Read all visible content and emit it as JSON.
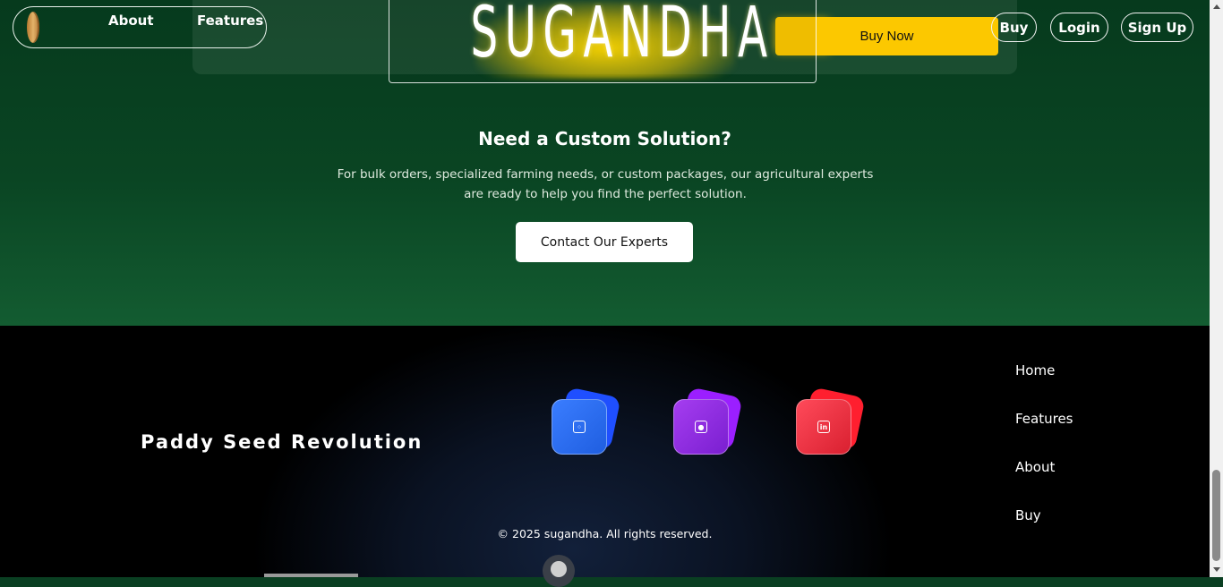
{
  "brand": {
    "logo_text": "SUGANDHA"
  },
  "product_card": {
    "buy_now_label": "Buy Now"
  },
  "nav": {
    "left_links": [
      "About",
      "Features"
    ],
    "right_buttons": [
      "Buy",
      "Login",
      "Sign Up"
    ],
    "logo_icon": "seed-icon"
  },
  "cta": {
    "title": "Need a Custom Solution?",
    "description": "For bulk orders, specialized farming needs, or custom packages, our agricultural experts are ready to help you find the perfect solution.",
    "button_label": "Contact Our Experts"
  },
  "footer": {
    "tagline": "Paddy Seed Revolution",
    "social": [
      {
        "icon": "instagram-icon",
        "color": "#1f5eff"
      },
      {
        "icon": "github-icon",
        "color": "#8c1fff"
      },
      {
        "icon": "linkedin-icon",
        "color": "#ff1f2f"
      }
    ],
    "links": [
      "Home",
      "Features",
      "About",
      "Buy"
    ],
    "copyright": "© 2025 sugandha. All rights reserved."
  },
  "colors": {
    "accent_yellow": "#fcc800",
    "green_dark": "#063a1d",
    "green_light": "#135c31"
  }
}
